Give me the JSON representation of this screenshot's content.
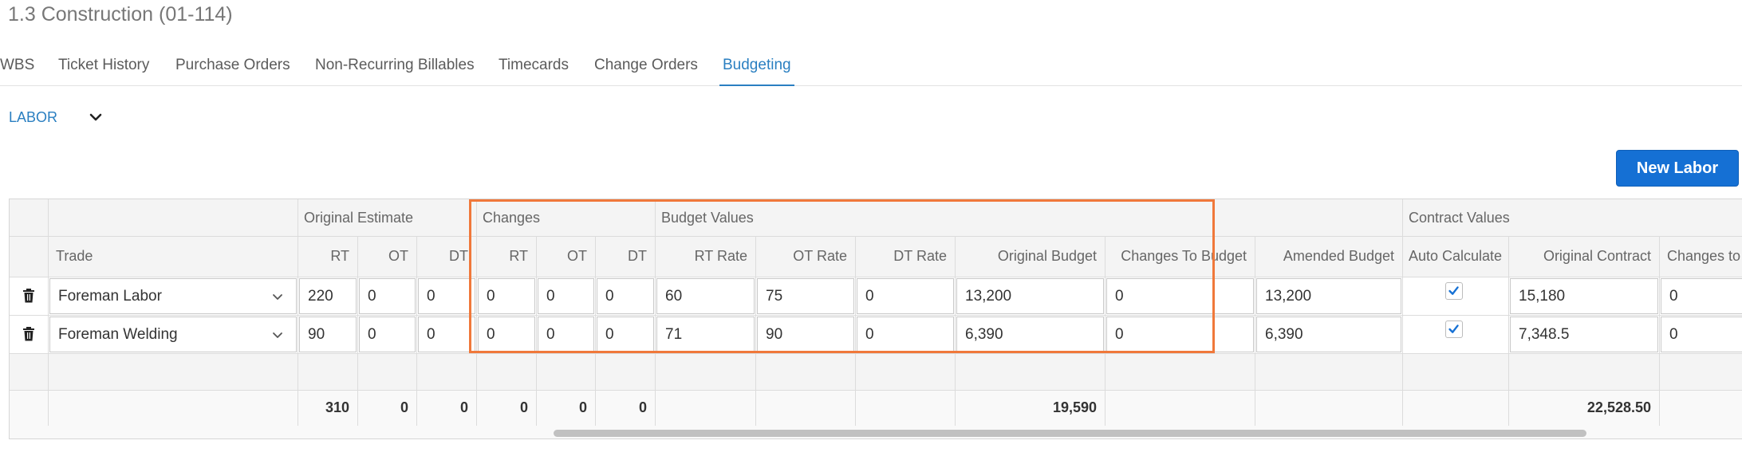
{
  "page": {
    "title": "1.3 Construction (01-114)"
  },
  "tabs": [
    {
      "label": "WBS"
    },
    {
      "label": "Ticket History"
    },
    {
      "label": "Purchase Orders"
    },
    {
      "label": "Non-Recurring Billables"
    },
    {
      "label": "Timecards"
    },
    {
      "label": "Change Orders"
    },
    {
      "label": "Budgeting",
      "active": true
    }
  ],
  "section": {
    "label": "LABOR",
    "toggle_icon": "chevron-down-icon"
  },
  "toolbar": {
    "new_label": "New Labor",
    "accent": "#1570d4"
  },
  "grid": {
    "groups": {
      "original_estimate": "Original Estimate",
      "changes": "Changes",
      "budget_values": "Budget Values",
      "contract_values": "Contract Values"
    },
    "columns": {
      "trade": "Trade",
      "oe_rt": "RT",
      "oe_ot": "OT",
      "oe_dt": "DT",
      "ch_rt": "RT",
      "ch_ot": "OT",
      "ch_dt": "DT",
      "rt_rate": "RT Rate",
      "ot_rate": "OT Rate",
      "dt_rate": "DT Rate",
      "original_budget": "Original Budget",
      "changes_to_budget": "Changes To Budget",
      "amended_budget": "Amended Budget",
      "auto_calculate": "Auto Calculate",
      "original_contract": "Original Contract",
      "changes_to_contract": "Changes to"
    },
    "rows": [
      {
        "trade": "Foreman Labor",
        "oe_rt": "220",
        "oe_ot": "0",
        "oe_dt": "0",
        "ch_rt": "0",
        "ch_ot": "0",
        "ch_dt": "0",
        "rt_rate": "60",
        "ot_rate": "75",
        "dt_rate": "0",
        "original_budget": "13,200",
        "changes_to_budget": "0",
        "amended_budget": "13,200",
        "auto_calculate": true,
        "original_contract": "15,180",
        "changes_to_contract": "0"
      },
      {
        "trade": "Foreman Welding",
        "oe_rt": "90",
        "oe_ot": "0",
        "oe_dt": "0",
        "ch_rt": "0",
        "ch_ot": "0",
        "ch_dt": "0",
        "rt_rate": "71",
        "ot_rate": "90",
        "dt_rate": "0",
        "original_budget": "6,390",
        "changes_to_budget": "0",
        "amended_budget": "6,390",
        "auto_calculate": true,
        "original_contract": "7,348.5",
        "changes_to_contract": "0"
      }
    ],
    "totals": {
      "oe_rt": "310",
      "oe_ot": "0",
      "oe_dt": "0",
      "ch_rt": "0",
      "ch_ot": "0",
      "ch_dt": "0",
      "original_budget": "19,590",
      "original_contract": "22,528.50"
    },
    "highlight_color": "#f0783a",
    "check_color": "#1570d4"
  }
}
